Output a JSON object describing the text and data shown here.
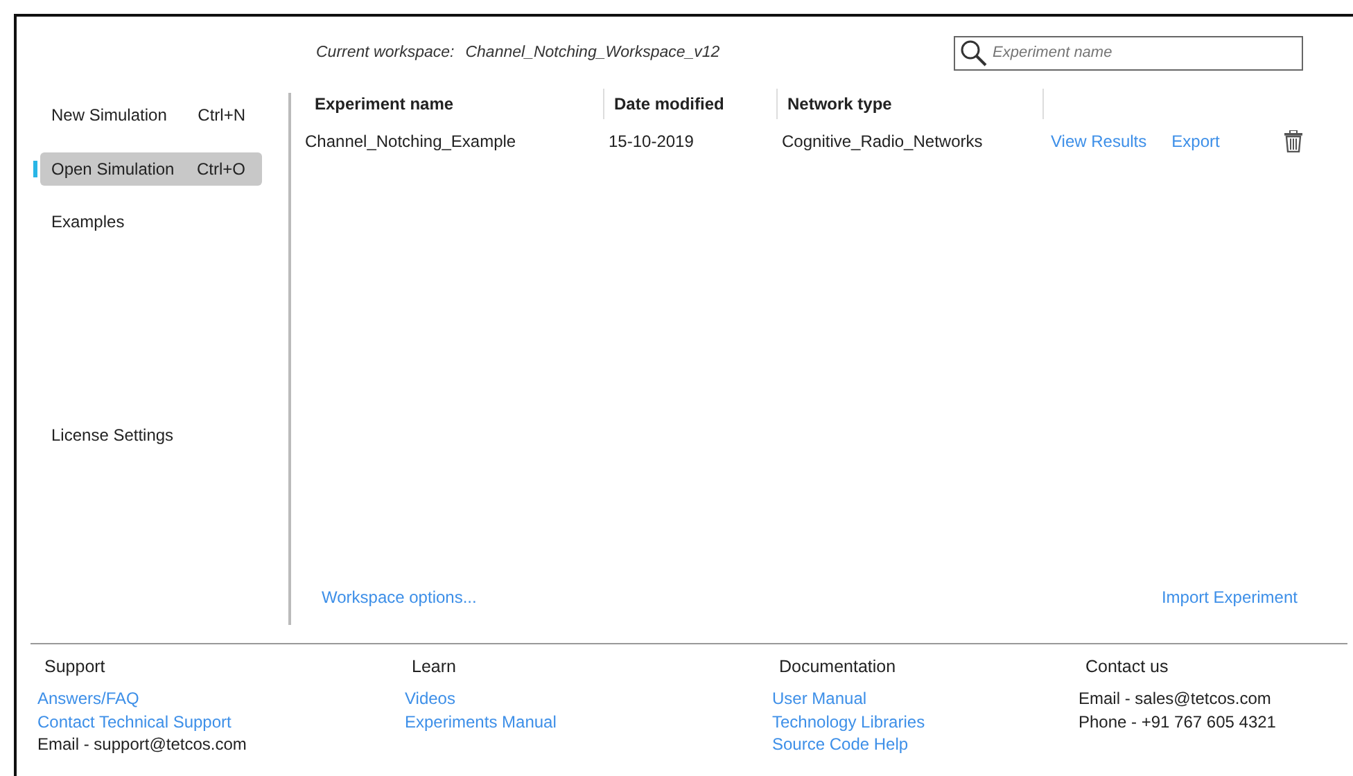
{
  "workspace": {
    "label": "Current workspace:",
    "name": "Channel_Notching_Workspace_v12"
  },
  "search": {
    "placeholder": "Experiment name"
  },
  "sidebar": {
    "items": [
      {
        "label": "New Simulation",
        "shortcut": "Ctrl+N",
        "selected": false
      },
      {
        "label": "Open Simulation",
        "shortcut": "Ctrl+O",
        "selected": true
      },
      {
        "label": "Examples",
        "selected": false
      },
      {
        "label": "License Settings",
        "selected": false
      }
    ]
  },
  "table": {
    "columns": [
      "Experiment name",
      "Date modified",
      "Network type"
    ],
    "rows": [
      {
        "cells": [
          "Channel_Notching_Example",
          "15-10-2019",
          "Cognitive_Radio_Networks"
        ],
        "actions": [
          "View Results",
          "Export"
        ]
      }
    ]
  },
  "workspace_options": "Workspace options...",
  "import_experiment": "Import Experiment",
  "footer": [
    {
      "title": "Support",
      "items": [
        {
          "kind": "link",
          "text": "Answers/FAQ"
        },
        {
          "kind": "link",
          "text": "Contact Technical Support"
        },
        {
          "kind": "text",
          "text": "Email - support@tetcos.com"
        }
      ]
    },
    {
      "title": "Learn",
      "items": [
        {
          "kind": "link",
          "text": "Videos"
        },
        {
          "kind": "link",
          "text": "Experiments Manual"
        }
      ]
    },
    {
      "title": "Documentation",
      "items": [
        {
          "kind": "link",
          "text": "User Manual"
        },
        {
          "kind": "link",
          "text": "Technology Libraries"
        },
        {
          "kind": "link",
          "text": "Source Code Help"
        }
      ]
    },
    {
      "title": "Contact us",
      "items": [
        {
          "kind": "text",
          "text": "Email - sales@tetcos.com"
        },
        {
          "kind": "text",
          "text": "Phone - +91 767 605 4321"
        }
      ]
    }
  ]
}
